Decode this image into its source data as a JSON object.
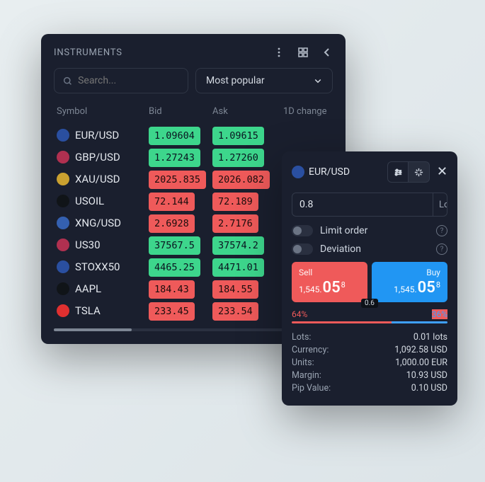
{
  "instruments": {
    "title": "INSTRUMENTS",
    "search_placeholder": "Search...",
    "dropdown": "Most popular",
    "cols": {
      "symbol": "Symbol",
      "bid": "Bid",
      "ask": "Ask",
      "change": "1D change"
    },
    "rows": [
      {
        "sym": "EUR/USD",
        "bid": "1.09604",
        "ask": "1.09615",
        "dir": "g",
        "flag": "#2a4fa0"
      },
      {
        "sym": "GBP/USD",
        "bid": "1.27243",
        "ask": "1.27260",
        "dir": "g",
        "flag": "#b03050"
      },
      {
        "sym": "XAU/USD",
        "bid": "2025.835",
        "ask": "2026.082",
        "dir": "r",
        "flag": "#caa130"
      },
      {
        "sym": "USOIL",
        "bid": "72.144",
        "ask": "72.189",
        "dir": "r",
        "flag": "#101418"
      },
      {
        "sym": "XNG/USD",
        "bid": "2.6928",
        "ask": "2.7176",
        "dir": "r",
        "flag": "#3460b0"
      },
      {
        "sym": "US30",
        "bid": "37567.5",
        "ask": "37574.2",
        "dir": "g",
        "flag": "#b03050"
      },
      {
        "sym": "STOXX50",
        "bid": "4465.25",
        "ask": "4471.01",
        "dir": "g",
        "flag": "#2a4fa0"
      },
      {
        "sym": "AAPL",
        "bid": "184.43",
        "ask": "184.55",
        "dir": "r",
        "flag": "#101418"
      },
      {
        "sym": "TSLA",
        "bid": "233.45",
        "ask": "233.54",
        "dir": "r",
        "flag": "#e03030"
      }
    ]
  },
  "order": {
    "symbol": "EUR/USD",
    "size": "0.8",
    "unit": "Lots",
    "limit": "Limit order",
    "deviation": "Deviation",
    "sell": {
      "label": "Sell",
      "pre": "1,545.",
      "big": "05",
      "sup": "8"
    },
    "buy": {
      "label": "Buy",
      "pre": "1,545.",
      "big": "05",
      "sup": "8"
    },
    "spread": "0.6",
    "sent_left": "64%",
    "sent_right": "36%",
    "sent_left_w": 64,
    "sent_right_w": 36,
    "details": [
      {
        "k": "Lots:",
        "v": "0.01 lots"
      },
      {
        "k": "Currency:",
        "v": "1,092.58 USD"
      },
      {
        "k": "Units:",
        "v": "1,000.00 EUR"
      },
      {
        "k": "Margin:",
        "v": "10.93 USD"
      },
      {
        "k": "Pip Value:",
        "v": "0.10 USD"
      }
    ]
  }
}
